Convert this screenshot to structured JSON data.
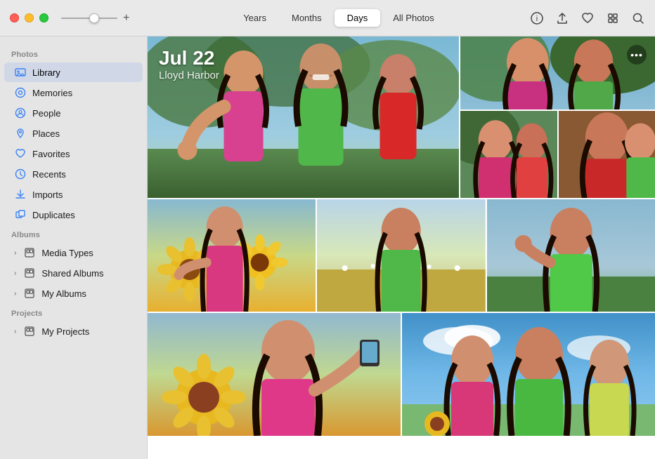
{
  "app": {
    "title": "Photos"
  },
  "titlebar": {
    "traffic_lights": [
      "red",
      "yellow",
      "green"
    ],
    "plus_label": "+",
    "nav_tabs": [
      {
        "id": "years",
        "label": "Years",
        "active": false
      },
      {
        "id": "months",
        "label": "Months",
        "active": false
      },
      {
        "id": "days",
        "label": "Days",
        "active": true
      },
      {
        "id": "all_photos",
        "label": "All Photos",
        "active": false
      }
    ],
    "icons": [
      "info",
      "share",
      "heart",
      "square",
      "search"
    ]
  },
  "sidebar": {
    "sections": [
      {
        "label": "Photos",
        "items": [
          {
            "id": "library",
            "label": "Library",
            "icon": "📷",
            "active": true
          },
          {
            "id": "memories",
            "label": "Memories",
            "icon": "⊙"
          },
          {
            "id": "people",
            "label": "People",
            "icon": "⊙"
          },
          {
            "id": "places",
            "label": "Places",
            "icon": "↑"
          },
          {
            "id": "favorites",
            "label": "Favorites",
            "icon": "♡"
          },
          {
            "id": "recents",
            "label": "Recents",
            "icon": "⊙"
          },
          {
            "id": "imports",
            "label": "Imports",
            "icon": "⬆"
          },
          {
            "id": "duplicates",
            "label": "Duplicates",
            "icon": "⧉"
          }
        ]
      },
      {
        "label": "Albums",
        "items": [
          {
            "id": "media-types",
            "label": "Media Types",
            "icon": "⊟",
            "expandable": true
          },
          {
            "id": "shared-albums",
            "label": "Shared Albums",
            "icon": "⊟",
            "expandable": true
          },
          {
            "id": "my-albums",
            "label": "My Albums",
            "icon": "⊟",
            "expandable": true
          }
        ]
      },
      {
        "label": "Projects",
        "items": [
          {
            "id": "my-projects",
            "label": "My Projects",
            "icon": "⊟",
            "expandable": true
          }
        ]
      }
    ]
  },
  "content": {
    "day_header": {
      "date": "Jul 22",
      "location": "Lloyd Harbor"
    },
    "more_button": "•••"
  }
}
